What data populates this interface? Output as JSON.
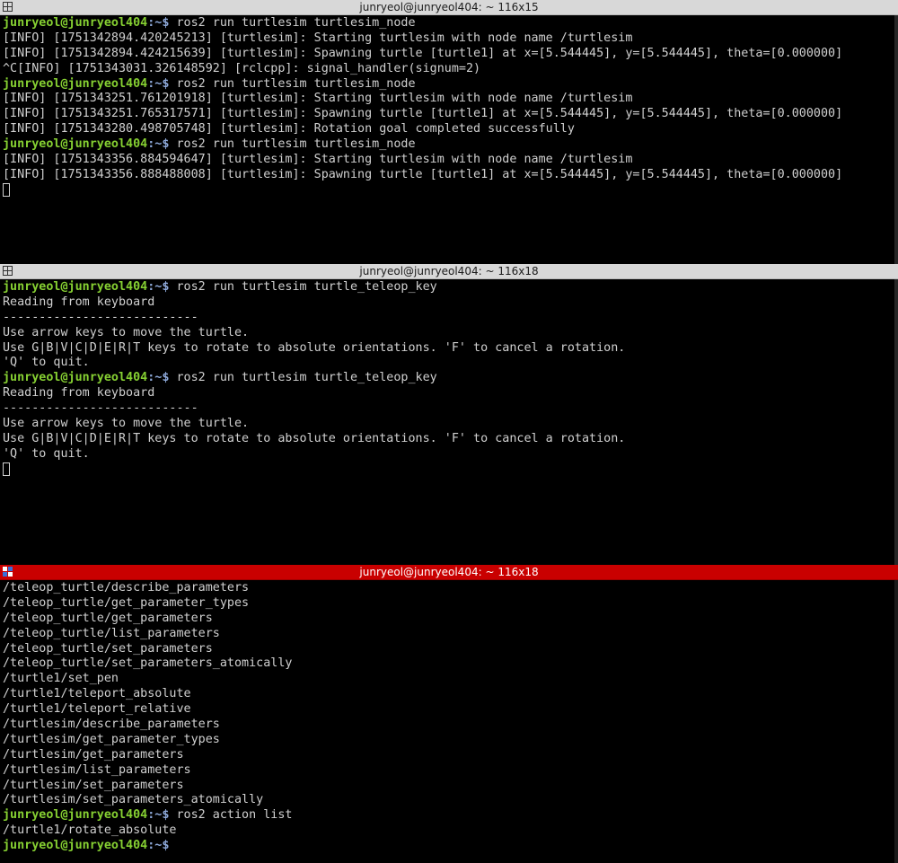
{
  "colors": {
    "prompt_user": "#86d032",
    "prompt_path": "#8da8d8",
    "text": "#d0d0d0",
    "titlebar_inactive": "#d8d8d8",
    "titlebar_active": "#c90000",
    "background": "#000000"
  },
  "prompt": {
    "user": "junryeol@junryeol404",
    "path": ":~$"
  },
  "panes": [
    {
      "title": "junryeol@junryeol404: ~ 116x15",
      "title_icon": "split-pane-icon",
      "lines": [
        {
          "cmd": " ros2 run turtlesim turtlesim_node"
        },
        {
          "text": "[INFO] [1751342894.420245213] [turtlesim]: Starting turtlesim with node name /turtlesim"
        },
        {
          "text": "[INFO] [1751342894.424215639] [turtlesim]: Spawning turtle [turtle1] at x=[5.544445], y=[5.544445], theta=[0.000000]"
        },
        {
          "text": "^C[INFO] [1751343031.326148592] [rclcpp]: signal_handler(signum=2)"
        },
        {
          "cmd": " ros2 run turtlesim turtlesim_node"
        },
        {
          "text": "[INFO] [1751343251.761201918] [turtlesim]: Starting turtlesim with node name /turtlesim"
        },
        {
          "text": "[INFO] [1751343251.765317571] [turtlesim]: Spawning turtle [turtle1] at x=[5.544445], y=[5.544445], theta=[0.000000]"
        },
        {
          "text": "[INFO] [1751343280.498705748] [turtlesim]: Rotation goal completed successfully"
        },
        {
          "cmd": " ros2 run turtlesim turtlesim_node"
        },
        {
          "text": "[INFO] [1751343356.884594647] [turtlesim]: Starting turtlesim with node name /turtlesim"
        },
        {
          "text": "[INFO] [1751343356.888488008] [turtlesim]: Spawning turtle [turtle1] at x=[5.544445], y=[5.544445], theta=[0.000000]"
        },
        {
          "cursor": true
        }
      ]
    },
    {
      "title": "junryeol@junryeol404: ~ 116x18",
      "title_icon": "split-pane-icon",
      "lines": [
        {
          "cmd": " ros2 run turtlesim turtle_teleop_key"
        },
        {
          "text": "Reading from keyboard"
        },
        {
          "text": "---------------------------"
        },
        {
          "text": "Use arrow keys to move the turtle."
        },
        {
          "text": "Use G|B|V|C|D|E|R|T keys to rotate to absolute orientations. 'F' to cancel a rotation."
        },
        {
          "text": "'Q' to quit."
        },
        {
          "cmd": " ros2 run turtlesim turtle_teleop_key"
        },
        {
          "text": "Reading from keyboard"
        },
        {
          "text": "---------------------------"
        },
        {
          "text": "Use arrow keys to move the turtle."
        },
        {
          "text": "Use G|B|V|C|D|E|R|T keys to rotate to absolute orientations. 'F' to cancel a rotation."
        },
        {
          "text": "'Q' to quit."
        },
        {
          "cursor": true
        }
      ]
    },
    {
      "title": "junryeol@junryeol404: ~ 116x18",
      "title_icon": "split-pane-active-icon",
      "active": true,
      "lines": [
        {
          "text": "/teleop_turtle/describe_parameters"
        },
        {
          "text": "/teleop_turtle/get_parameter_types"
        },
        {
          "text": "/teleop_turtle/get_parameters"
        },
        {
          "text": "/teleop_turtle/list_parameters"
        },
        {
          "text": "/teleop_turtle/set_parameters"
        },
        {
          "text": "/teleop_turtle/set_parameters_atomically"
        },
        {
          "text": "/turtle1/set_pen"
        },
        {
          "text": "/turtle1/teleport_absolute"
        },
        {
          "text": "/turtle1/teleport_relative"
        },
        {
          "text": "/turtlesim/describe_parameters"
        },
        {
          "text": "/turtlesim/get_parameter_types"
        },
        {
          "text": "/turtlesim/get_parameters"
        },
        {
          "text": "/turtlesim/list_parameters"
        },
        {
          "text": "/turtlesim/set_parameters"
        },
        {
          "text": "/turtlesim/set_parameters_atomically"
        },
        {
          "cmd": " ros2 action list"
        },
        {
          "text": "/turtle1/rotate_absolute"
        },
        {
          "cmd": "",
          "cursor_after": false
        }
      ]
    }
  ]
}
